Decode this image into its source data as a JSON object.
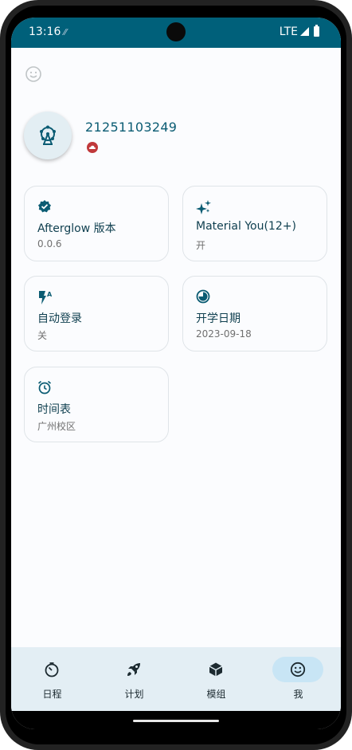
{
  "status_bar": {
    "time": "13:16",
    "network": "LTE"
  },
  "profile": {
    "username": "21251103249"
  },
  "cards": [
    {
      "icon": "verified-badge-icon",
      "title": "Afterglow 版本",
      "value": "0.0.6"
    },
    {
      "icon": "sparkle-icon",
      "title": "Material You(12+)",
      "value": "开"
    },
    {
      "icon": "flash-auto-icon",
      "title": "自动登录",
      "value": "关"
    },
    {
      "icon": "clock-pie-icon",
      "title": "开学日期",
      "value": "2023-09-18"
    },
    {
      "icon": "alarm-icon",
      "title": "时间表",
      "value": "广州校区"
    }
  ],
  "nav": {
    "items": [
      {
        "label": "日程",
        "icon": "timer-icon"
      },
      {
        "label": "计划",
        "icon": "rocket-icon"
      },
      {
        "label": "模组",
        "icon": "cube-icon"
      },
      {
        "label": "我",
        "icon": "smiley-icon"
      }
    ],
    "active_index": 3
  },
  "colors": {
    "status_bar": "#00607a",
    "accent": "#0b5c73",
    "nav_bg": "#e3eef4",
    "active_pill": "#c8e5f5",
    "cloud_badge": "#c0393b"
  }
}
